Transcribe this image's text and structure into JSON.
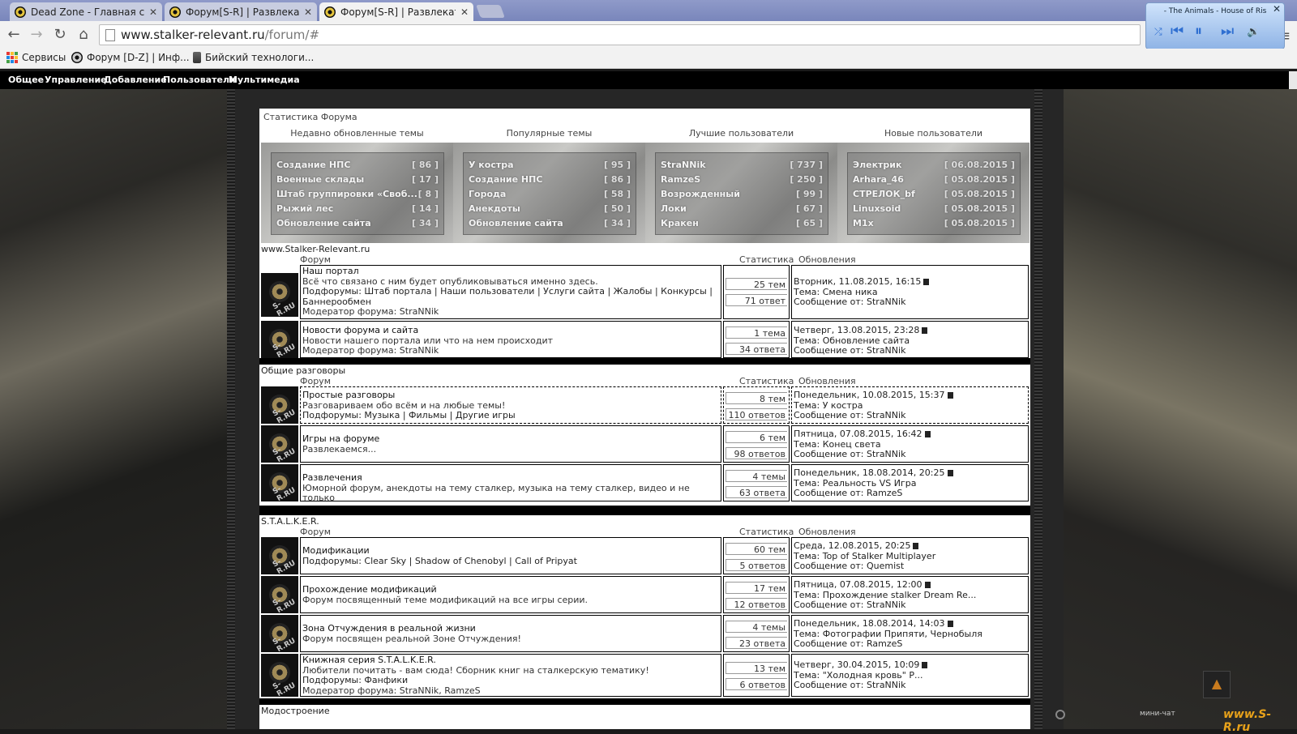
{
  "browser": {
    "tabs": [
      {
        "title": "Dead Zone - Главная стр"
      },
      {
        "title": "Форум[S-R] | Развлекате"
      },
      {
        "title": "Форум[S-R] | Развлекате"
      }
    ],
    "url_host": "www.stalker-relevant.ru",
    "url_path": "/forum/#",
    "bookmarks": [
      {
        "label": "Сервисы"
      },
      {
        "label": "Форум [D-Z] | Инф..."
      },
      {
        "label": "Бийский технологи..."
      }
    ]
  },
  "media_player": {
    "song": "- The Animals - House of Ris"
  },
  "site_nav": [
    "Общее",
    "Управление",
    "Добавление",
    "Пользователи",
    "Мультимедиа"
  ],
  "stats": {
    "title": "Статистика Форума",
    "columns": [
      {
        "header": "Недавно обновленные темы",
        "rows": [
          {
            "name": "Создание НПС",
            "count": "[ 86 ]"
          },
          {
            "name": "Военные склады",
            "count": "[ 17 ]"
          },
          {
            "name": "Штаб группировки «Своб...",
            "count": "[ 8 ]"
          },
          {
            "name": "Рыжий лес",
            "count": "[ 14 ]"
          },
          {
            "name": "Обновление сайта",
            "count": "[ 34 ]"
          }
        ]
      },
      {
        "header": "Популярные темы",
        "rows": [
          {
            "name": "У костра",
            "count": "[ 95 ]"
          },
          {
            "name": "Создание НПС",
            "count": "[ 86 ]"
          },
          {
            "name": "Города",
            "count": "[ 58 ]"
          },
          {
            "name": "Анекдоты",
            "count": "[ 50 ]"
          },
          {
            "name": "Обновление сайта",
            "count": "[ 34 ]"
          }
        ]
      },
      {
        "header": "Лучшие пользователи",
        "rows": [
          {
            "name": "StraNNik",
            "count": "[ 737 ]"
          },
          {
            "name": "RamzeS",
            "count": "[ 250 ]"
          },
          {
            "name": "Возрожденный",
            "count": "[ 99 ]"
          },
          {
            "name": "Локи",
            "count": "[ 67 ]"
          },
          {
            "name": "Кракен",
            "count": "[ 65 ]"
          }
        ]
      },
      {
        "header": "Новые пользователи",
        "rows": [
          {
            "name": "Электрик",
            "count": "[ 06.08.2015 ]"
          },
          {
            "name": "Arhara_46",
            "count": "[ 05.08.2015 ]"
          },
          {
            "name": "СТРЕЛОК_bf",
            "count": "[ 05.08.2015 ]"
          },
          {
            "name": "Linuxsoid",
            "count": "[ 05.08.2015 ]"
          },
          {
            "name": "M1x",
            "count": "[ 05.08.2015 ]"
          }
        ]
      }
    ]
  },
  "columns": {
    "forum": "Форум",
    "stats": "Статистика",
    "updates": "Обновления"
  },
  "sections": [
    {
      "title": "www.Stalker-Relevant.ru",
      "forums": [
        {
          "name": "Наш портал",
          "lines": [
            "Всё что связано с ним будет опубликовываться именно здесь.",
            "Подфорумы: Штаб портала | Наши пользователи | Услуги сайта | Жалобы | Конкурсы |",
            "Баннерообмен",
            "Модератор форума: StraNNik"
          ],
          "topics": "25 тем",
          "replies": "71 ответ",
          "upd_date": "Вторник, 11.08.2015, 16:15",
          "upd_topic": "Тема: Смена ника",
          "upd_author": "Сообщение от: StraNNik"
        },
        {
          "name": "Новости форума и сайта",
          "lines": [
            "Новости нашего портала или что на нем происходит",
            "Модератор форума: StraNNik"
          ],
          "topics": "1 тема",
          "replies": "34 ответа",
          "upd_date": "Четверг, 13.08.2015, 23:28",
          "upd_topic": "Тема: Обновление сайта",
          "upd_author": "Сообщение от: StraNNik"
        }
      ]
    },
    {
      "title": "Общие разговоры",
      "forums": [
        {
          "name": "Простые разговоры",
          "lines": [
            "Разговариваем обо всём и на любые темы!",
            "Подфорумы: Музыка | Фильмы | Другие игры"
          ],
          "topics": "8 тем",
          "replies": "110 ответов",
          "upd_date": "Понедельник, 10.08.2015, 15:37",
          "upd_topic": "Тема: У костра",
          "upd_author": "Сообщение от: StraNNik"
        },
        {
          "name": "Игры на форуме",
          "lines": [
            "Развлекаемся..."
          ],
          "topics": "6 тем",
          "replies": "98 ответов",
          "upd_date": "Пятница, 07.08.2015, 16:42",
          "upd_topic": "Тема: Конец света",
          "upd_author": "Сообщение от: StraNNik"
        },
        {
          "name": "Развлечения",
          "lines": [
            "Юморной форум, анекдоты на тему сталкер, музыка на тему сталкер, видео и не только"
          ],
          "topics": "4 темы",
          "replies": "63 ответа",
          "upd_date": "Понедельник, 18.08.2014, 20:25",
          "upd_topic": "Тема: Реальность VS Игра",
          "upd_author": "Сообщение от: RamzeS"
        }
      ]
    },
    {
      "title": "S.T.A.L.K.E.R.",
      "forums": [
        {
          "name": "Модификации",
          "lines": [
            "Подфорумы: Clear Sky | Shadow of Chenobyl | Call of Pripyat"
          ],
          "topics": "60 тем",
          "replies": "5 ответов",
          "upd_date": "Среда, 12.08.2015, 20:25",
          "upd_topic": "Тема: Top of Stalker Multiplayer",
          "upd_author": "Сообщение от: Quemist"
        },
        {
          "name": "Прохождение модификаций",
          "lines": [
            "Форум посвященный теме модификаций на все игры серии."
          ],
          "topics": "17 тем",
          "replies": "12 ответов",
          "upd_date": "Пятница, 07.08.2015, 12:00",
          "upd_topic": "Тема: Прохождение stalker Dream Re...",
          "upd_author": "Сообщение от: StraNNik"
        },
        {
          "name": "Зона Отчуждения в реальной жизни",
          "lines": [
            "Форум посвящен реальной Зоне Отчуждения!"
          ],
          "topics": "4 темы",
          "replies": "23 ответа",
          "upd_date": "Понедельник, 18.08.2014, 14:03",
          "upd_topic": "Тема: Фотографии Припяти, Чернобыля",
          "upd_author": "Сообщение от: RamzeS"
        },
        {
          "name": "Книжная серия S.T.A.L.K.E.R.",
          "lines": [
            "Любители почитать - вам сюда! Сборник книг на сталкерскую тематику!",
            "Подфорумы: Фанфики",
            "Модератор форума: StraNNik, RamzeS"
          ],
          "topics": "13 тем",
          "replies": "6 ответов",
          "upd_date": "Четверг, 30.04.2015, 10:09",
          "upd_topic": "Тема: \"Холодная кровь\" Р...",
          "upd_author": "Сообщение от: StraNNik"
        }
      ]
    },
    {
      "title": "Модостроение",
      "forums": []
    }
  ],
  "footer": {
    "minichat": "мини-чат",
    "logo": "www.S-R.ru"
  }
}
